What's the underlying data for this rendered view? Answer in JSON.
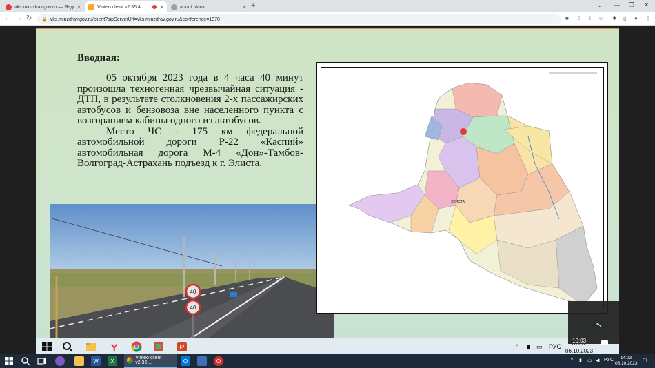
{
  "browser": {
    "tabs": [
      {
        "title": "vks.minzdrav.gov.ru — Яндекс:",
        "active": false,
        "favicon_color": "#e53935"
      },
      {
        "title": "Vinteo client v2.36.4",
        "active": true,
        "favicon_color": "#f9a825"
      },
      {
        "title": "about:blank",
        "active": false,
        "favicon_color": "#5f6368"
      }
    ],
    "url": "vks.minzdrav.gov.ru/client?sipServerUrl=vks.minzdrav.gov.ru&conference=1070"
  },
  "slide": {
    "heading": "Вводная:",
    "paragraph1": "05 октября 2023 года в 4 часа 40 минут произошла техногенная чрезвычайная ситуация - ДТП, в результате столкновения 2-х пассажирских автобусов и бензовоза вне населенного пункта с возгоранием кабины одного из автобусов.",
    "paragraph2": "Место ЧС - 175 км федеральной автомобильной дороги Р-22 «Каспий» автомобильная дорога М-4 «Дон»-Тамбов-Волгоград-Астрахань подъезд к г. Элиста.",
    "sign_speed_1": "40",
    "sign_speed_2": "40",
    "map_city_label": "ЭЛИСТА",
    "accident_color": "#e53935"
  },
  "remote_taskbar": {
    "language": "РУС",
    "time": "10:03",
    "date": "06.10.2023"
  },
  "overlay": {
    "time": "10:03"
  },
  "taskbar": {
    "active_app": "Vinteo client v2.36....",
    "language": "РУС",
    "time": "14:03",
    "date": "06.10.2023"
  }
}
